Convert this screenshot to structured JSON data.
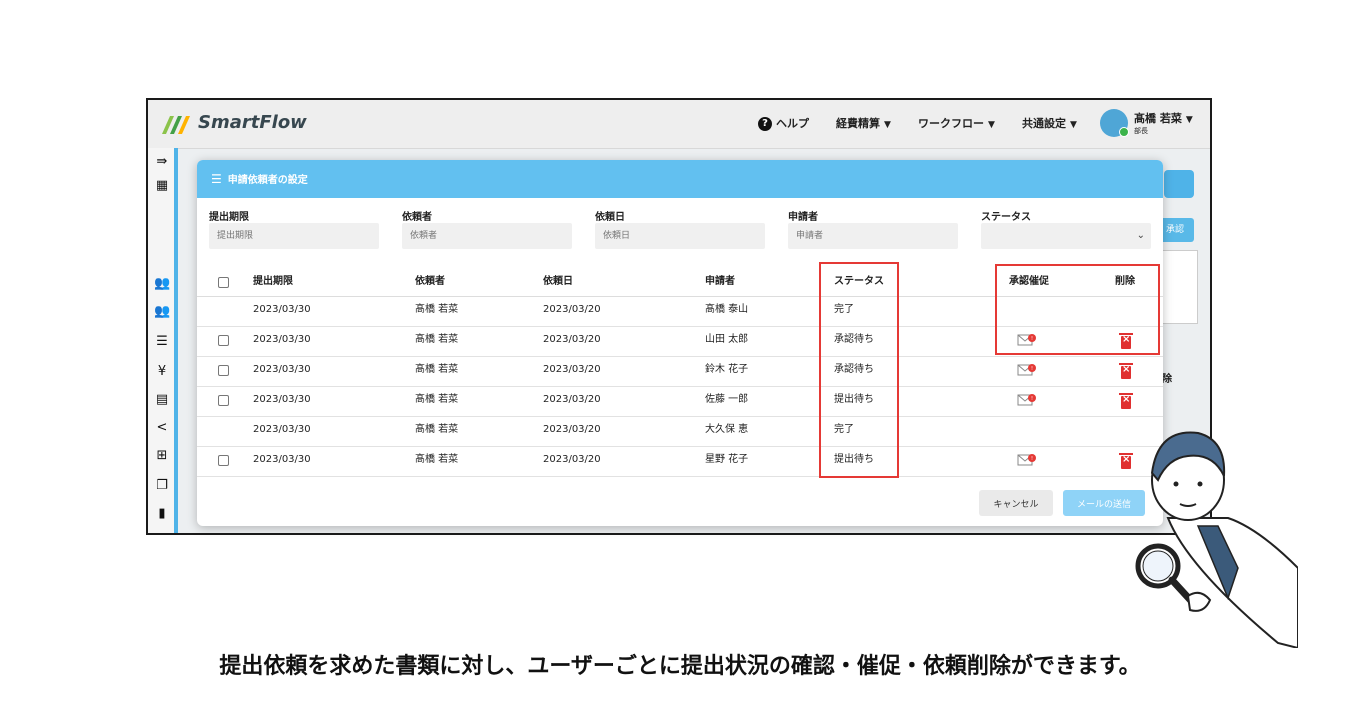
{
  "app": {
    "brand": "SmartFlow"
  },
  "topnav": {
    "help": "ヘルプ",
    "expense": "経費精算",
    "workflow": "ワークフロー",
    "common": "共通設定",
    "user_name": "髙橋 若菜",
    "user_role": "部長"
  },
  "background": {
    "approve_btn": "承認",
    "delete_hdr": "除"
  },
  "modal": {
    "title": "申請依頼者の設定",
    "filters": [
      {
        "label": "提出期限",
        "placeholder": "提出期限"
      },
      {
        "label": "依頼者",
        "placeholder": "依頼者"
      },
      {
        "label": "依頼日",
        "placeholder": "依頼日"
      },
      {
        "label": "申請者",
        "placeholder": "申請者"
      },
      {
        "label": "ステータス",
        "placeholder": ""
      }
    ],
    "columns": {
      "deadline": "提出期限",
      "requester": "依頼者",
      "request_date": "依頼日",
      "applicant": "申請者",
      "status": "ステータス",
      "remind": "承認催促",
      "delete": "削除"
    },
    "rows": [
      {
        "checkbox": false,
        "deadline": "2023/03/30",
        "requester": "髙橋 若菜",
        "request_date": "2023/03/20",
        "applicant": "髙橋 泰山",
        "status": "完了",
        "actions": false
      },
      {
        "checkbox": true,
        "deadline": "2023/03/30",
        "requester": "髙橋 若菜",
        "request_date": "2023/03/20",
        "applicant": "山田 太郎",
        "status": "承認待ち",
        "actions": true
      },
      {
        "checkbox": true,
        "deadline": "2023/03/30",
        "requester": "髙橋 若菜",
        "request_date": "2023/03/20",
        "applicant": "鈴木 花子",
        "status": "承認待ち",
        "actions": true
      },
      {
        "checkbox": true,
        "deadline": "2023/03/30",
        "requester": "髙橋 若菜",
        "request_date": "2023/03/20",
        "applicant": "佐藤 一郎",
        "status": "提出待ち",
        "actions": true
      },
      {
        "checkbox": false,
        "deadline": "2023/03/30",
        "requester": "髙橋 若菜",
        "request_date": "2023/03/20",
        "applicant": "大久保 恵",
        "status": "完了",
        "actions": false
      },
      {
        "checkbox": true,
        "deadline": "2023/03/30",
        "requester": "髙橋 若菜",
        "request_date": "2023/03/20",
        "applicant": "星野 花子",
        "status": "提出待ち",
        "actions": true
      }
    ],
    "cancel": "キャンセル",
    "send": "メールの送信"
  },
  "caption": "提出依頼を求めた書類に対し、ユーザーごとに提出状況の確認・催促・依頼削除ができます。",
  "colors": {
    "accent": "#62c0f0",
    "highlight": "#e53935",
    "delete": "#e03030"
  }
}
